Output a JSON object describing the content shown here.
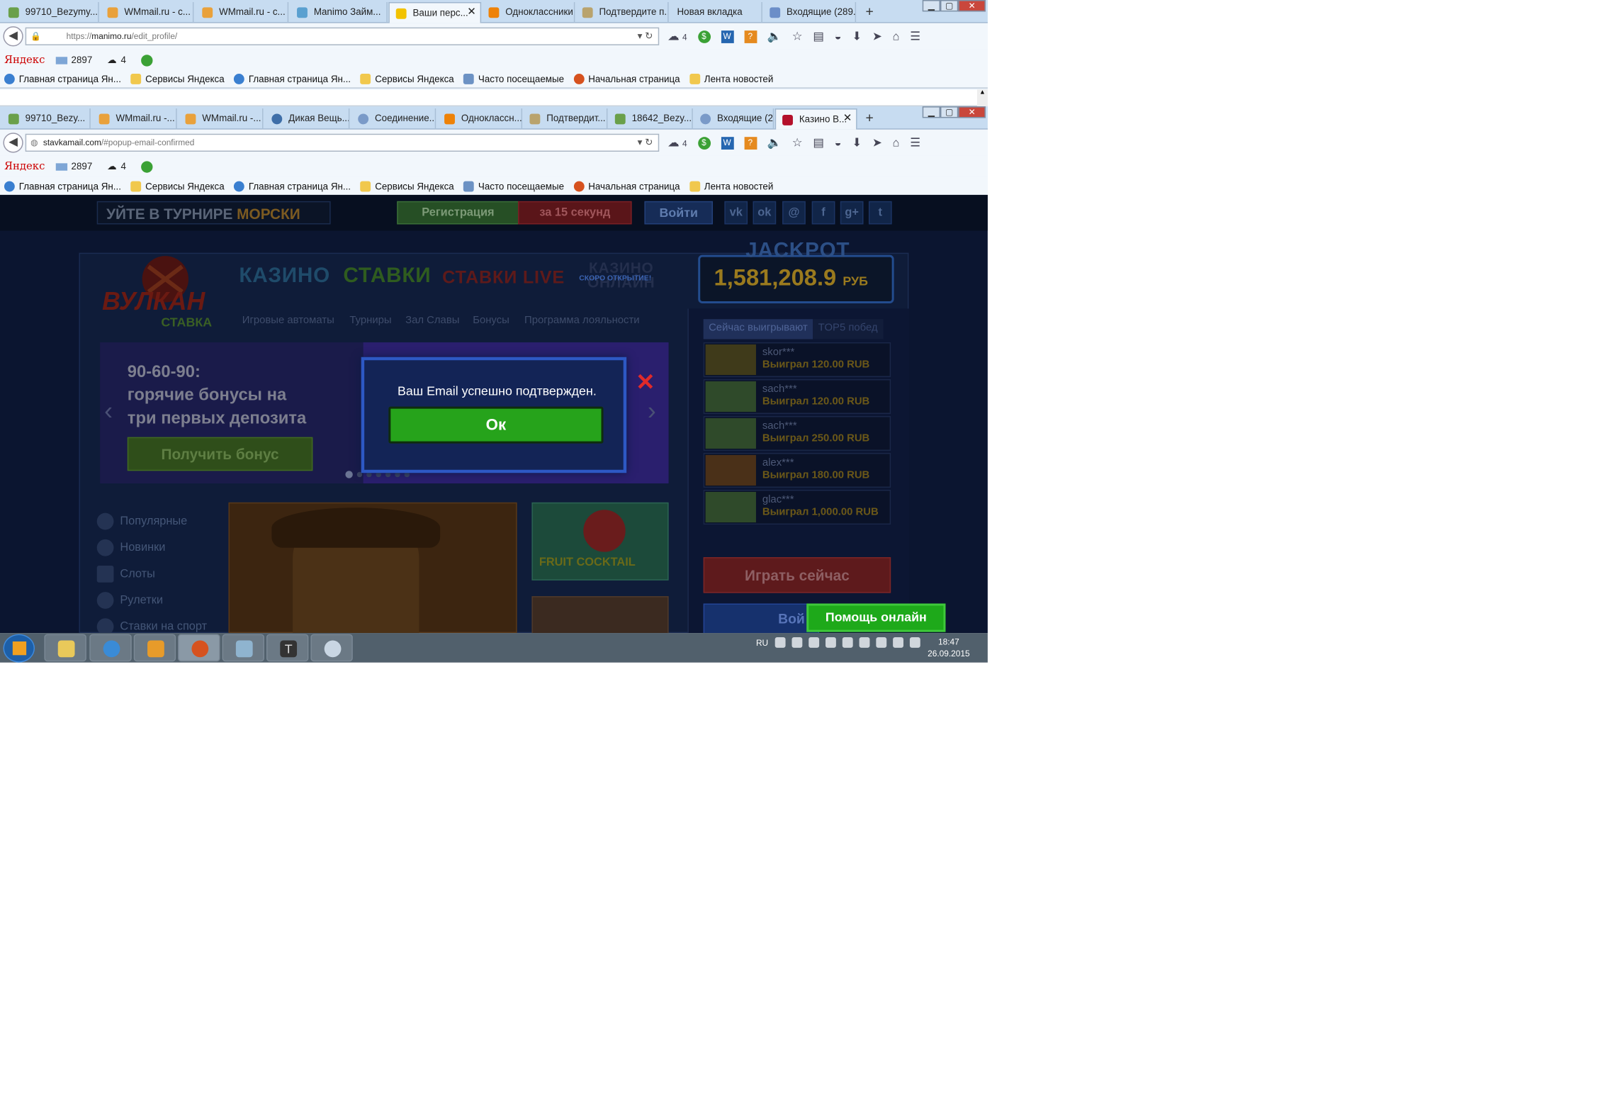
{
  "browser1": {
    "tabs": [
      {
        "label": "99710_Bezymy..."
      },
      {
        "label": "WMmail.ru - c..."
      },
      {
        "label": "WMmail.ru - c..."
      },
      {
        "label": "Manimo Займ..."
      },
      {
        "label": "Ваши перс..."
      },
      {
        "label": "Одноклассники"
      },
      {
        "label": "Подтвердите п..."
      },
      {
        "label": "Новая вкладка"
      },
      {
        "label": "Входящие (289..."
      }
    ],
    "url": "https://manimo.ru/edit_profile/",
    "url_domain": "manimo.ru",
    "url_prefix": "https://",
    "url_path": "/edit_profile/",
    "weather": "4"
  },
  "browser2": {
    "tabs": [
      {
        "label": "99710_Bezy..."
      },
      {
        "label": "WMmail.ru -..."
      },
      {
        "label": "WMmail.ru -..."
      },
      {
        "label": "Дикая Вещь..."
      },
      {
        "label": "Соединение..."
      },
      {
        "label": "Одноклассн..."
      },
      {
        "label": "Подтвердит..."
      },
      {
        "label": "18642_Bezy..."
      },
      {
        "label": "Входящие (2..."
      },
      {
        "label": "Казино В..."
      }
    ],
    "url_domain": "stavkamail.com",
    "url_path": "/#popup-email-confirmed",
    "weather": "4"
  },
  "yandex_bar": {
    "logo": "Яндекс",
    "mail_count": "2897",
    "weather": "4"
  },
  "bookmarks": [
    "Главная страница Ян...",
    "Сервисы Яндекса",
    "Главная страница Ян...",
    "Сервисы Яндекса",
    "Часто посещаемые",
    "Начальная страница",
    "Лента новостей"
  ],
  "casino": {
    "ticker_pre": "УЙТЕ В ТУРНИРЕ",
    "ticker_post": "МОРСКИ",
    "register": "Регистрация",
    "register_seconds": "за 15 секунд",
    "login": "Войти",
    "logo_main": "ВУЛКАН",
    "logo_sub": "СТАВКА",
    "tab_casino": "КАЗИНО",
    "tab_bets": "СТАВКИ",
    "tab_bets_live": "СТАВКИ LIVE",
    "tab_casino_online": "КАЗИНО ОНЛАЙН",
    "soon": "СКОРО ОТКРЫТИЕ!",
    "jackpot_title": "JACKPOT",
    "jackpot_value": "1,581,208.9",
    "jackpot_cur": "РУБ",
    "subnav": [
      "Игровые автоматы",
      "Турниры",
      "Зал Славы",
      "Бонусы",
      "Программа лояльности"
    ],
    "banner_line1": "90-60-90:",
    "banner_line2": "горячие бонусы на",
    "banner_line3": "три первых депозита",
    "banner_button": "Получить бонус",
    "categories": [
      "Популярные",
      "Новинки",
      "Слоты",
      "Рулетки",
      "Ставки на спорт"
    ],
    "game2_label": "FRUIT COCKTAIL",
    "right_tab_active": "Сейчас выигрывают",
    "right_tab_other": "TOP5 побед",
    "winners": [
      {
        "user": "skor***",
        "amount": "Выиграл 120.00 RUB"
      },
      {
        "user": "sach***",
        "amount": "Выиграл 120.00 RUB"
      },
      {
        "user": "sach***",
        "amount": "Выиграл 250.00 RUB"
      },
      {
        "user": "alex***",
        "amount": "Выиграл 180.00 RUB"
      },
      {
        "user": "glac***",
        "amount": "Выиграл 1,000.00 RUB"
      }
    ],
    "play_now": "Играть сейчас",
    "login2": "Вой",
    "help_online": "Помощь онлайн"
  },
  "modal": {
    "message": "Ваш Email успешно подтвержден.",
    "ok": "Ок"
  },
  "taskbar": {
    "lang": "RU",
    "time": "18:47",
    "date": "26.09.2015"
  }
}
